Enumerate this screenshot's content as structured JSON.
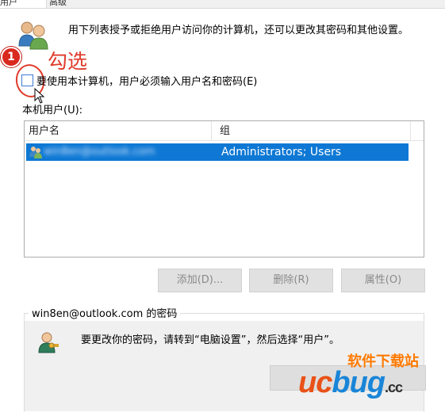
{
  "tabs": [
    {
      "label": "用户"
    },
    {
      "label": "高级"
    }
  ],
  "info_text": "用下列表授予或拒绝用户访问你的计算机，还可以更改其密码和其他设置。",
  "annotation": {
    "step_number": "1",
    "text": "勾选"
  },
  "require_password": {
    "label": "要使用本计算机，用户必须输入用户名和密码(E)",
    "checked": false
  },
  "users_section": {
    "label": "本机用户(U):",
    "columns": [
      "用户名",
      "组"
    ],
    "rows": [
      {
        "user": "win8en@outlook.com",
        "group": "Administrators; Users",
        "selected": true
      }
    ]
  },
  "buttons": {
    "add": "添加(D)...",
    "remove": "删除(R)",
    "properties": "属性(O)"
  },
  "password_group": {
    "title": "win8en@outlook.com 的密码",
    "text": "要更改你的密码，请转到“电脑设置”，然后选择“用户”。"
  },
  "watermark": {
    "cn": "软件下载站",
    "en_part1": "uc",
    "en_part2": "bug",
    "en_suffix": ".cc"
  },
  "colors": {
    "selection": "#0e78d4",
    "annotation_red": "#e03a2a",
    "dialog_gray": "#f0f0f0"
  }
}
